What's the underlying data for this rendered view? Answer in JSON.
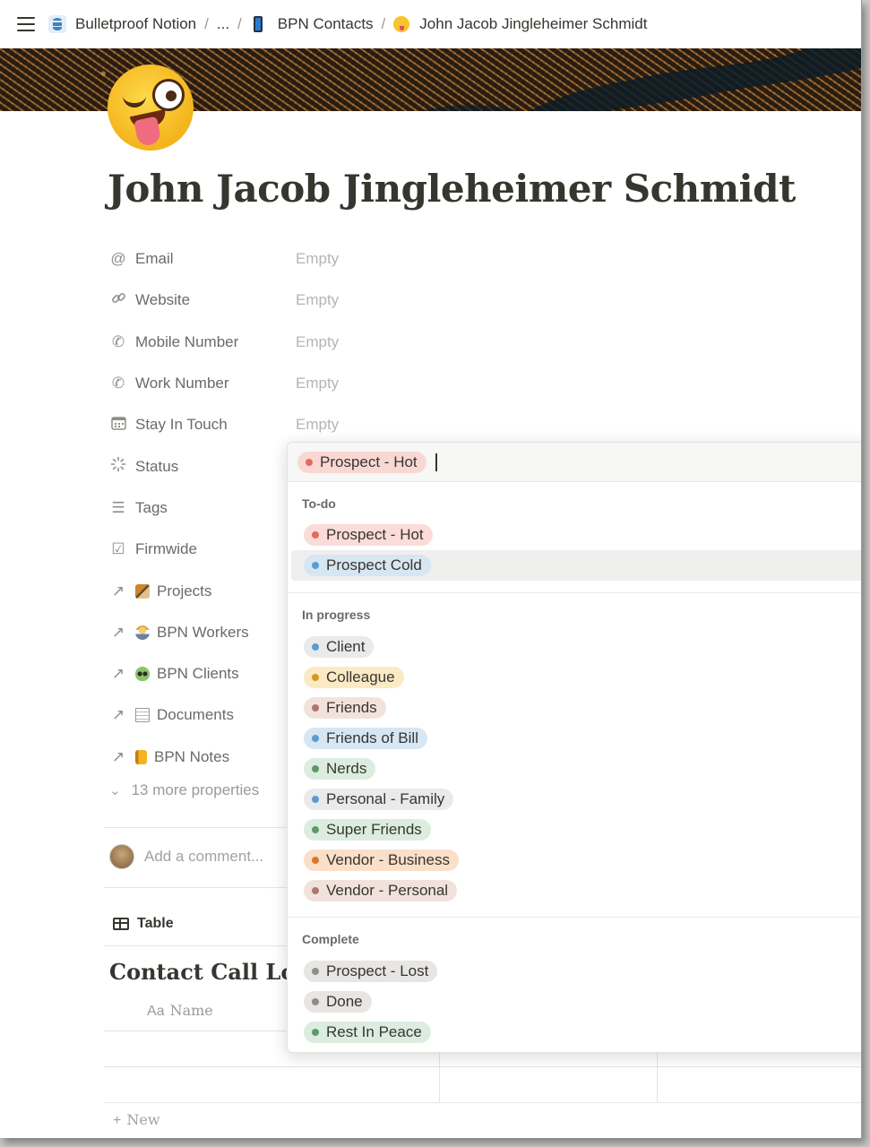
{
  "breadcrumb": [
    {
      "label": "Bulletproof Notion"
    },
    {
      "label": "..."
    },
    {
      "label": "BPN Contacts"
    },
    {
      "label": "John Jacob Jingleheimer Schmidt"
    }
  ],
  "page": {
    "title": "John Jacob Jingleheimer Schmidt"
  },
  "properties": [
    {
      "name": "Email",
      "icon": "at-icon",
      "value": "Empty"
    },
    {
      "name": "Website",
      "icon": "link-icon",
      "value": "Empty"
    },
    {
      "name": "Mobile Number",
      "icon": "phone-icon",
      "value": "Empty"
    },
    {
      "name": "Work Number",
      "icon": "phone-icon",
      "value": "Empty"
    },
    {
      "name": "Stay In Touch",
      "icon": "calendar-icon",
      "value": "Empty"
    },
    {
      "name": "Status",
      "icon": "status-icon",
      "value": ""
    },
    {
      "name": "Tags",
      "icon": "list-icon",
      "value": ""
    },
    {
      "name": "Firmwide",
      "icon": "checkbox-icon",
      "value": ""
    },
    {
      "name": "Projects",
      "icon": "relation-arrow-icon",
      "value": ""
    },
    {
      "name": "BPN Workers",
      "icon": "relation-arrow-icon",
      "value": ""
    },
    {
      "name": "BPN Clients",
      "icon": "relation-arrow-icon",
      "value": ""
    },
    {
      "name": "Documents",
      "icon": "relation-arrow-icon",
      "value": ""
    },
    {
      "name": "BPN Notes",
      "icon": "relation-arrow-icon",
      "value": ""
    }
  ],
  "more_properties": "13 more properties",
  "comment_placeholder": "Add a comment...",
  "view_tab": "Table",
  "database": {
    "title": "Contact Call Log",
    "name_column_icon": "Aa",
    "name_column": "Name",
    "new_label": "New"
  },
  "status_dropdown": {
    "selected": {
      "label": "Prospect - Hot",
      "color": "#f9d8d3",
      "dot": "#e16b5c"
    },
    "groups": [
      {
        "name": "To-do",
        "options": [
          {
            "label": "Prospect - Hot",
            "bg": "#fbdcd8",
            "dot": "#e16b5c"
          },
          {
            "label": "Prospect Cold",
            "bg": "#d6e6f3",
            "dot": "#5a9bd0"
          }
        ]
      },
      {
        "name": "In progress",
        "options": [
          {
            "label": "Client",
            "bg": "#ebeaea",
            "dot": "#5a9bd0"
          },
          {
            "label": "Colleague",
            "bg": "#fbeac4",
            "dot": "#d29a1f"
          },
          {
            "label": "Friends",
            "bg": "#f2e2dc",
            "dot": "#b1786a"
          },
          {
            "label": "Friends of Bill",
            "bg": "#d6e6f3",
            "dot": "#5a9bd0"
          },
          {
            "label": "Nerds",
            "bg": "#dcede0",
            "dot": "#5c9a6b"
          },
          {
            "label": "Personal - Family",
            "bg": "#ebeaea",
            "dot": "#5a9bd0"
          },
          {
            "label": "Super Friends",
            "bg": "#dcede0",
            "dot": "#5c9a6b"
          },
          {
            "label": "Vendor - Business",
            "bg": "#fadfc9",
            "dot": "#d9772a"
          },
          {
            "label": "Vendor - Personal",
            "bg": "#f2e2dc",
            "dot": "#b1786a"
          }
        ]
      },
      {
        "name": "Complete",
        "options": [
          {
            "label": "Prospect - Lost",
            "bg": "#e7e6e4",
            "dot": "#8f8d89"
          },
          {
            "label": "Done",
            "bg": "#e7e6e4",
            "dot": "#8f8d89"
          },
          {
            "label": "Rest In Peace",
            "bg": "#dcede0",
            "dot": "#5c9a6b"
          }
        ]
      }
    ]
  }
}
